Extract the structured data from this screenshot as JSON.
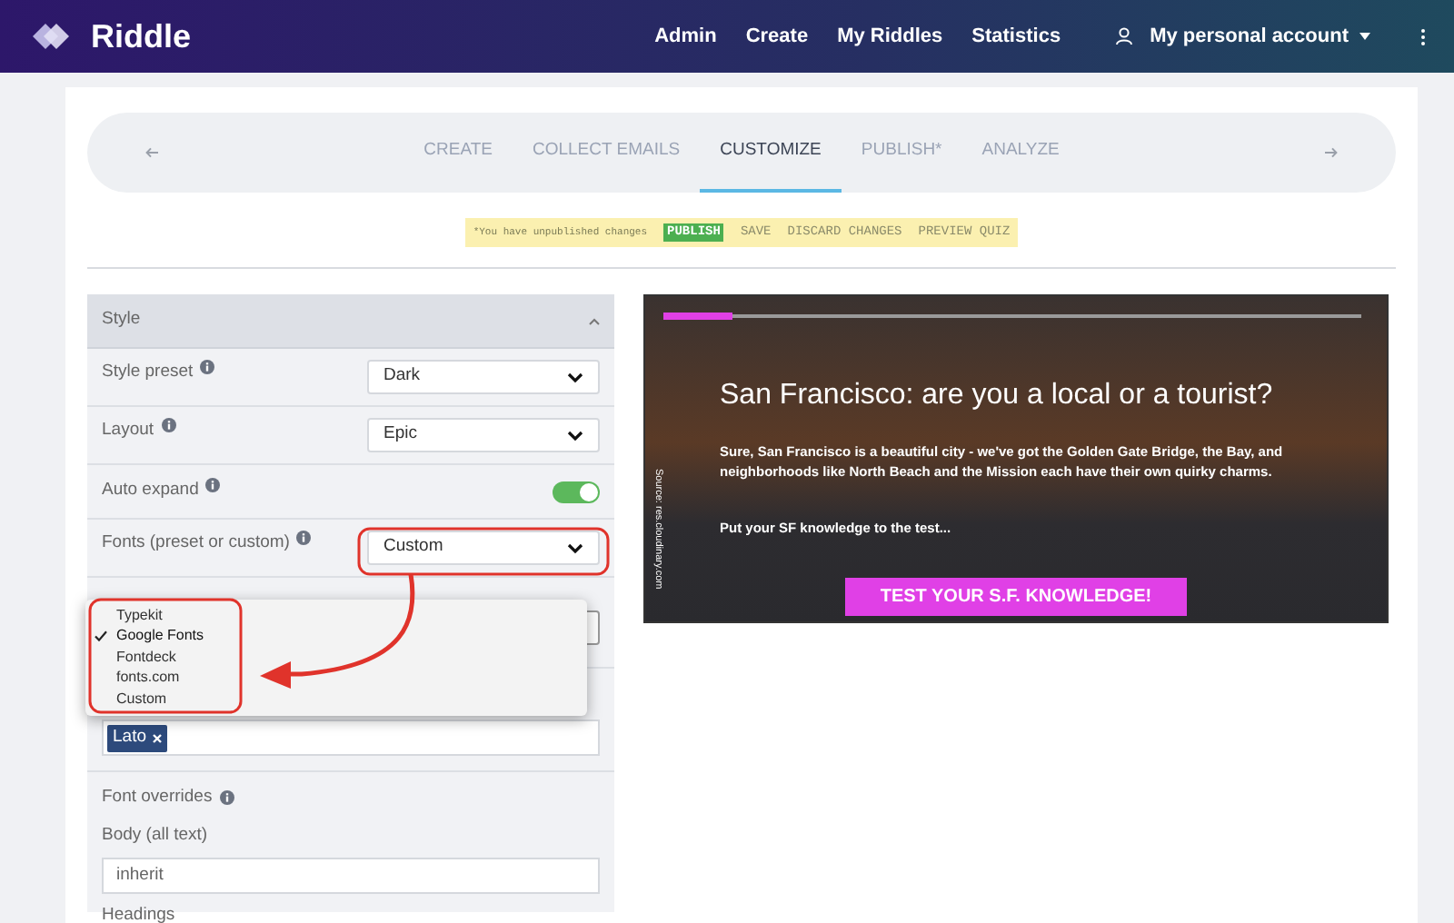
{
  "header": {
    "logo": "Riddle",
    "nav": [
      "Admin",
      "Create",
      "My Riddles",
      "Statistics"
    ],
    "account": "My personal account"
  },
  "steps": [
    {
      "label": "CREATE",
      "selected": false
    },
    {
      "label": "COLLECT EMAILS",
      "selected": false
    },
    {
      "label": "CUSTOMIZE",
      "selected": true
    },
    {
      "label": "PUBLISH*",
      "selected": false
    },
    {
      "label": "ANALYZE",
      "selected": false
    }
  ],
  "notice": {
    "text": "*You have unpublished changes",
    "actions": [
      {
        "label": "PUBLISH",
        "kind": "primary"
      },
      {
        "label": "SAVE",
        "kind": "plain"
      },
      {
        "label": "DISCARD CHANGES",
        "kind": "plain"
      },
      {
        "label": "PREVIEW QUIZ",
        "kind": "plain"
      }
    ]
  },
  "panel": {
    "title": "Style",
    "rows": [
      {
        "kind": "select",
        "label": "Style preset",
        "value": "Dark"
      },
      {
        "kind": "select",
        "label": "Layout",
        "value": "Epic"
      },
      {
        "kind": "toggle",
        "label": "Auto expand",
        "on": true
      },
      {
        "kind": "select",
        "label": "Fonts (preset or custom)",
        "value": "Custom"
      }
    ],
    "dropdown": [
      {
        "label": "Typekit",
        "selected": false
      },
      {
        "label": "Google Fonts",
        "selected": true
      },
      {
        "label": "Fontdeck",
        "selected": false
      },
      {
        "label": "fonts.com",
        "selected": false
      },
      {
        "label": "Custom",
        "selected": false
      }
    ],
    "font_tags": [
      "Lato"
    ],
    "overrides_label": "Font overrides",
    "body_label": "Body (all text)",
    "body_value": "inherit",
    "headings_label": "Headings"
  },
  "preview": {
    "title": "San Francisco: are you a local or a tourist?",
    "description": "Sure, San Francisco is a beautiful city - we've got the Golden Gate Bridge, the Bay, and neighborhoods like North Beach and the Mission each have their own quirky charms.",
    "prompt": "Put your SF knowledge to the test...",
    "button": "TEST YOUR S.F. KNOWLEDGE!",
    "source": "Source: res.cloudinary.com",
    "level": 0.1
  }
}
